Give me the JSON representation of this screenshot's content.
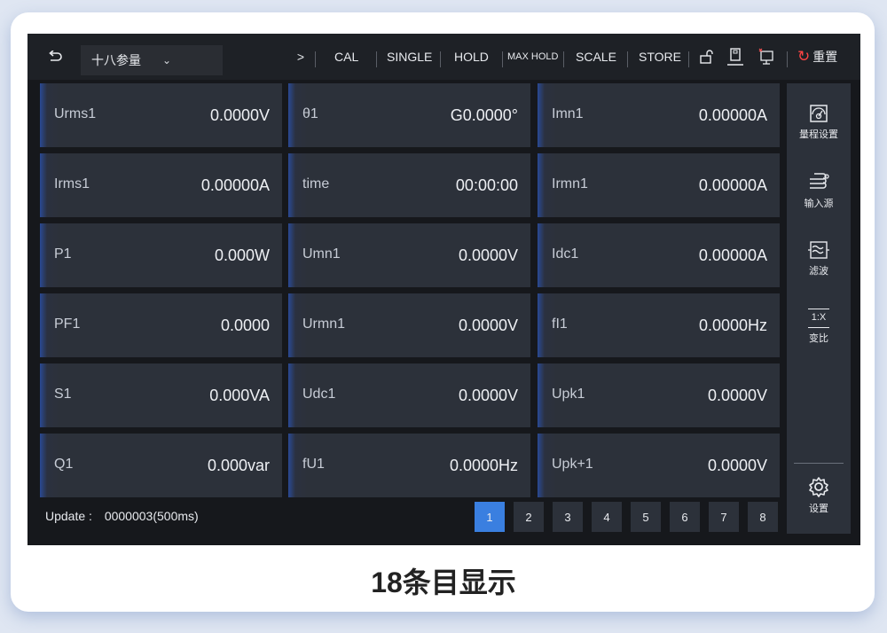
{
  "toolbar": {
    "back_icon": "undo-arrow-icon",
    "dropdown_label": "十八参量",
    "chevron": "⌄",
    "next": ">",
    "buttons": [
      "CAL",
      "SINGLE",
      "HOLD",
      "MAX HOLD",
      "SCALE",
      "STORE"
    ],
    "reset_label": "重置"
  },
  "cells": [
    {
      "label": "Urms1",
      "value": "0.0000V"
    },
    {
      "label": "θ1",
      "value": "G0.0000°"
    },
    {
      "label": "Imn1",
      "value": "0.00000A"
    },
    {
      "label": "Irms1",
      "value": "0.00000A"
    },
    {
      "label": "time",
      "value": "00:00:00"
    },
    {
      "label": "Irmn1",
      "value": "0.00000A"
    },
    {
      "label": "P1",
      "value": "0.000W"
    },
    {
      "label": "Umn1",
      "value": "0.0000V"
    },
    {
      "label": "Idc1",
      "value": "0.00000A"
    },
    {
      "label": "PF1",
      "value": "0.0000"
    },
    {
      "label": "Urmn1",
      "value": "0.0000V"
    },
    {
      "label": "fI1",
      "value": "0.0000Hz"
    },
    {
      "label": "S1",
      "value": "0.000VA"
    },
    {
      "label": "Udc1",
      "value": "0.0000V"
    },
    {
      "label": "Upk1",
      "value": "0.0000V"
    },
    {
      "label": "Q1",
      "value": "0.000var"
    },
    {
      "label": "fU1",
      "value": "0.0000Hz"
    },
    {
      "label": "Upk+1",
      "value": "0.0000V"
    }
  ],
  "side": {
    "range": "量程设置",
    "input": "输入源",
    "filter": "滤波",
    "ratio": "变比",
    "ratio_icon_text": "1:X",
    "settings": "设置"
  },
  "status": {
    "update_label": "Update :",
    "update_value": "0000003(500ms)"
  },
  "pages": [
    "1",
    "2",
    "3",
    "4",
    "5",
    "6",
    "7",
    "8"
  ],
  "active_page": "1",
  "caption": "18条目显示",
  "colors": {
    "active_page": "#3a7fe0",
    "reset_icon": "#ff4444",
    "cell_accent": "#2a4a95"
  }
}
